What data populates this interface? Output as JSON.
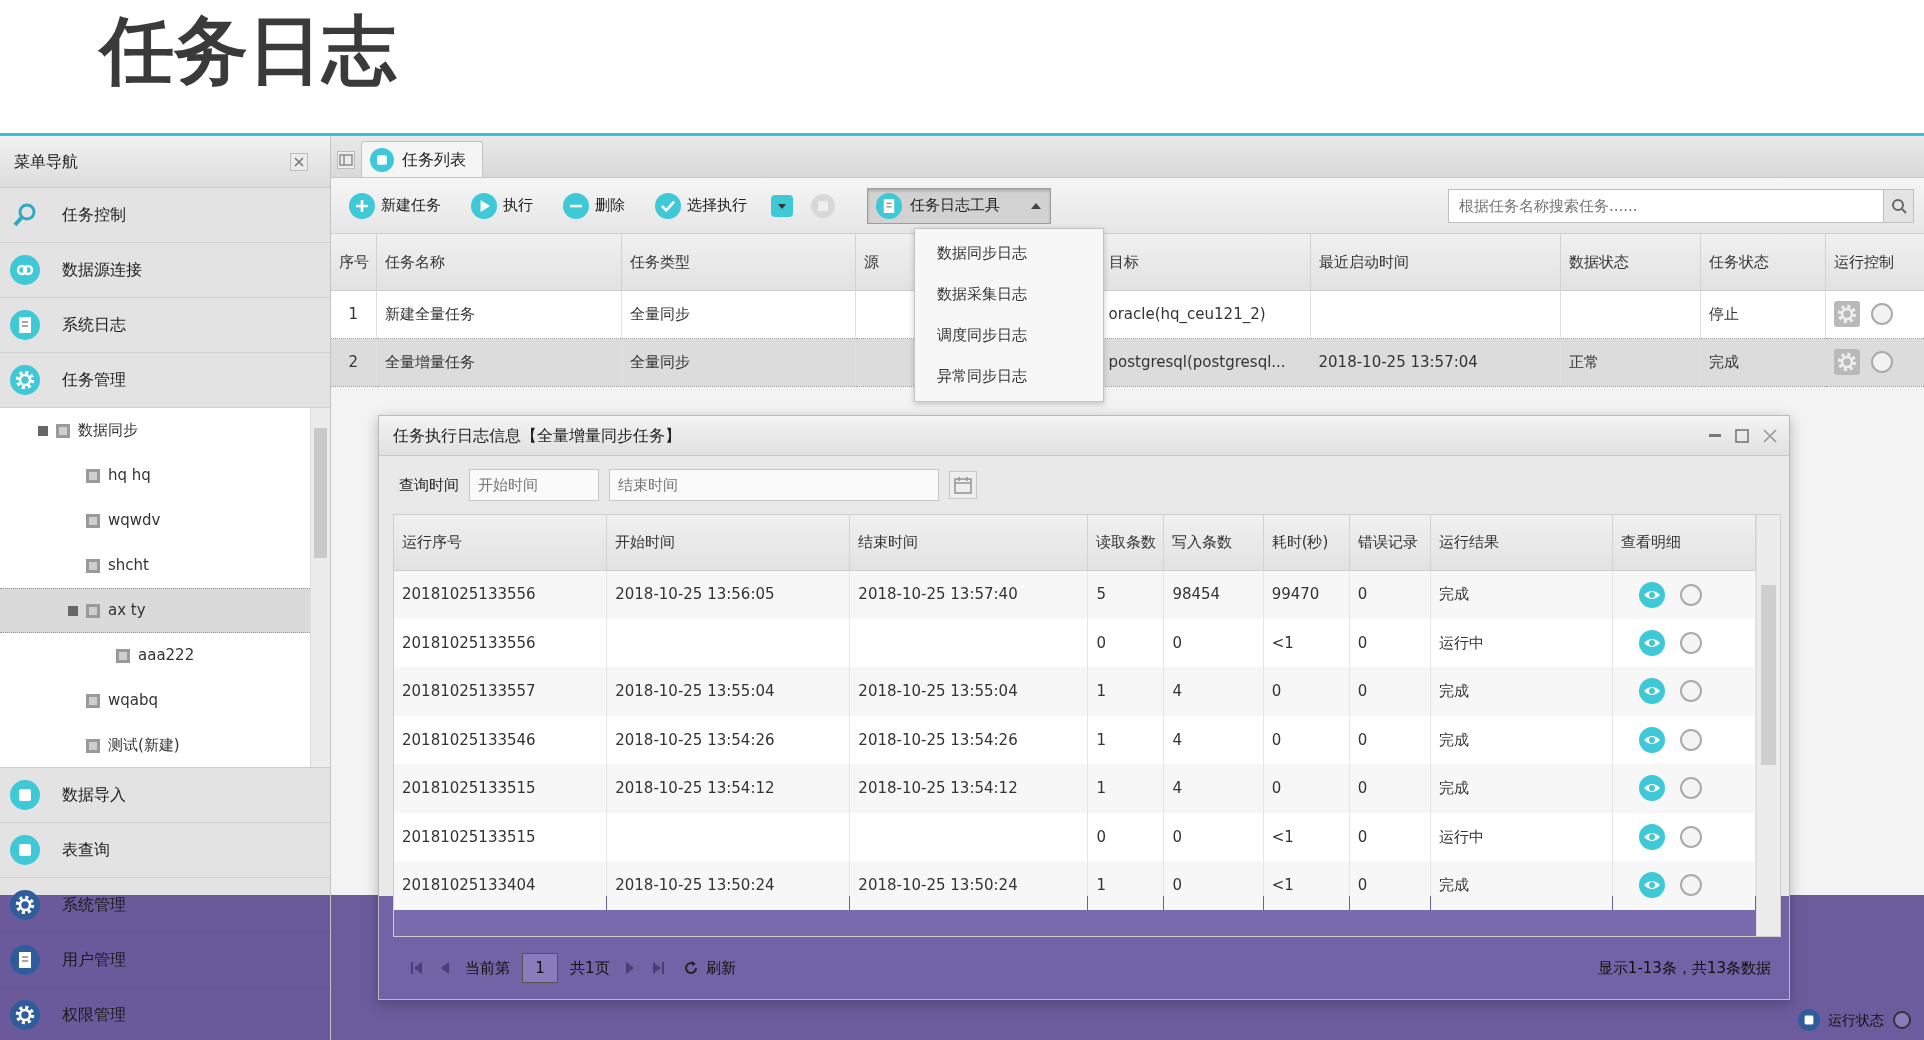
{
  "page_title": "任务日志",
  "sidebar": {
    "title": "菜单导航",
    "items_top": [
      {
        "label": "任务控制"
      },
      {
        "label": "数据源连接"
      },
      {
        "label": "系统日志"
      },
      {
        "label": "任务管理"
      }
    ],
    "tree": [
      {
        "label": "数据同步",
        "selected": false,
        "children": [
          {
            "label": "hq hq",
            "selected": false
          },
          {
            "label": "wqwdv",
            "selected": false
          },
          {
            "label": "shcht",
            "selected": false
          },
          {
            "label": "ax ty",
            "selected": true,
            "children": [
              {
                "label": "aaa222",
                "selected": false
              }
            ]
          },
          {
            "label": "wqabq",
            "selected": false
          },
          {
            "label": "测试(新建)",
            "selected": false
          }
        ]
      }
    ],
    "items_bottom": [
      {
        "label": "数据导入"
      },
      {
        "label": "表查询"
      },
      {
        "label": "系统管理"
      },
      {
        "label": "用户管理"
      },
      {
        "label": "权限管理"
      }
    ]
  },
  "tabs": [
    {
      "label": "任务列表",
      "selected": true
    }
  ],
  "toolbar": {
    "buttons": [
      {
        "label": "新建任务"
      },
      {
        "label": "执行"
      },
      {
        "label": "删除"
      },
      {
        "label": "选择执行"
      }
    ],
    "log_tool": {
      "label": "任务日志工具",
      "expanded": true,
      "items": [
        "数据同步日志",
        "数据采集日志",
        "调度同步日志",
        "异常同步日志"
      ]
    }
  },
  "search": {
    "placeholder": "根据任务名称搜索任务......"
  },
  "task_table": {
    "columns": [
      "序号",
      "任务名称",
      "任务类型",
      "源",
      "目标",
      "最近启动时间",
      "数据状态",
      "任务状态",
      "运行控制"
    ],
    "rows": [
      {
        "selected": false,
        "no": "1",
        "name": "新建全量任务",
        "type": "全量同步",
        "target": "oracle(hq_ceu121_2)",
        "task_status": "停止"
      },
      {
        "selected": true,
        "no": "2",
        "name": "全量增量任务",
        "type": "全量同步",
        "target": "postgresql(postgresql...",
        "last_start": "2018-10-25 13:57:04",
        "data_status": "正常",
        "task_status": "完成"
      }
    ]
  },
  "dialog": {
    "title": "任务执行日志信息【全量增量同步任务】",
    "query_label": "查询时间",
    "start_placeholder": "开始时间",
    "end_placeholder": "结束时间",
    "columns": [
      "运行序号",
      "开始时间",
      "结束时间",
      "读取条数",
      "写入条数",
      "耗时(秒)",
      "错误记录",
      "运行结果",
      "查看明细"
    ],
    "rows": [
      {
        "run_id": "20181025133556",
        "start": "2018-10-25 13:56:05",
        "end": "2018-10-25 13:57:40",
        "read": "5",
        "written": "98454",
        "seconds": "99470",
        "errors": "0",
        "result": "完成"
      },
      {
        "run_id": "20181025133556",
        "read": "0",
        "written": "0",
        "seconds": "<1",
        "errors": "0",
        "result": "运行中"
      },
      {
        "run_id": "20181025133557",
        "start": "2018-10-25 13:55:04",
        "end": "2018-10-25 13:55:04",
        "read": "1",
        "written": "4",
        "seconds": "0",
        "errors": "0",
        "result": "完成"
      },
      {
        "run_id": "20181025133546",
        "start": "2018-10-25 13:54:26",
        "end": "2018-10-25 13:54:26",
        "read": "1",
        "written": "4",
        "seconds": "0",
        "errors": "0",
        "result": "完成"
      },
      {
        "run_id": "20181025133515",
        "start": "2018-10-25 13:54:12",
        "end": "2018-10-25 13:54:12",
        "read": "1",
        "written": "4",
        "seconds": "0",
        "errors": "0",
        "result": "完成"
      },
      {
        "run_id": "20181025133515",
        "read": "0",
        "written": "0",
        "seconds": "<1",
        "errors": "0",
        "result": "运行中"
      },
      {
        "run_id": "20181025133404",
        "start": "2018-10-25 13:50:24",
        "end": "2018-10-25 13:50:24",
        "read": "1",
        "written": "0",
        "seconds": "<1",
        "errors": "0",
        "result": "完成"
      }
    ],
    "pager": {
      "before": "当前第",
      "page": "1",
      "after": "共1页",
      "refresh": "刷新"
    },
    "summary": "显示1-13条，共13条数据"
  },
  "status_bar": {
    "text": "运行状态"
  }
}
